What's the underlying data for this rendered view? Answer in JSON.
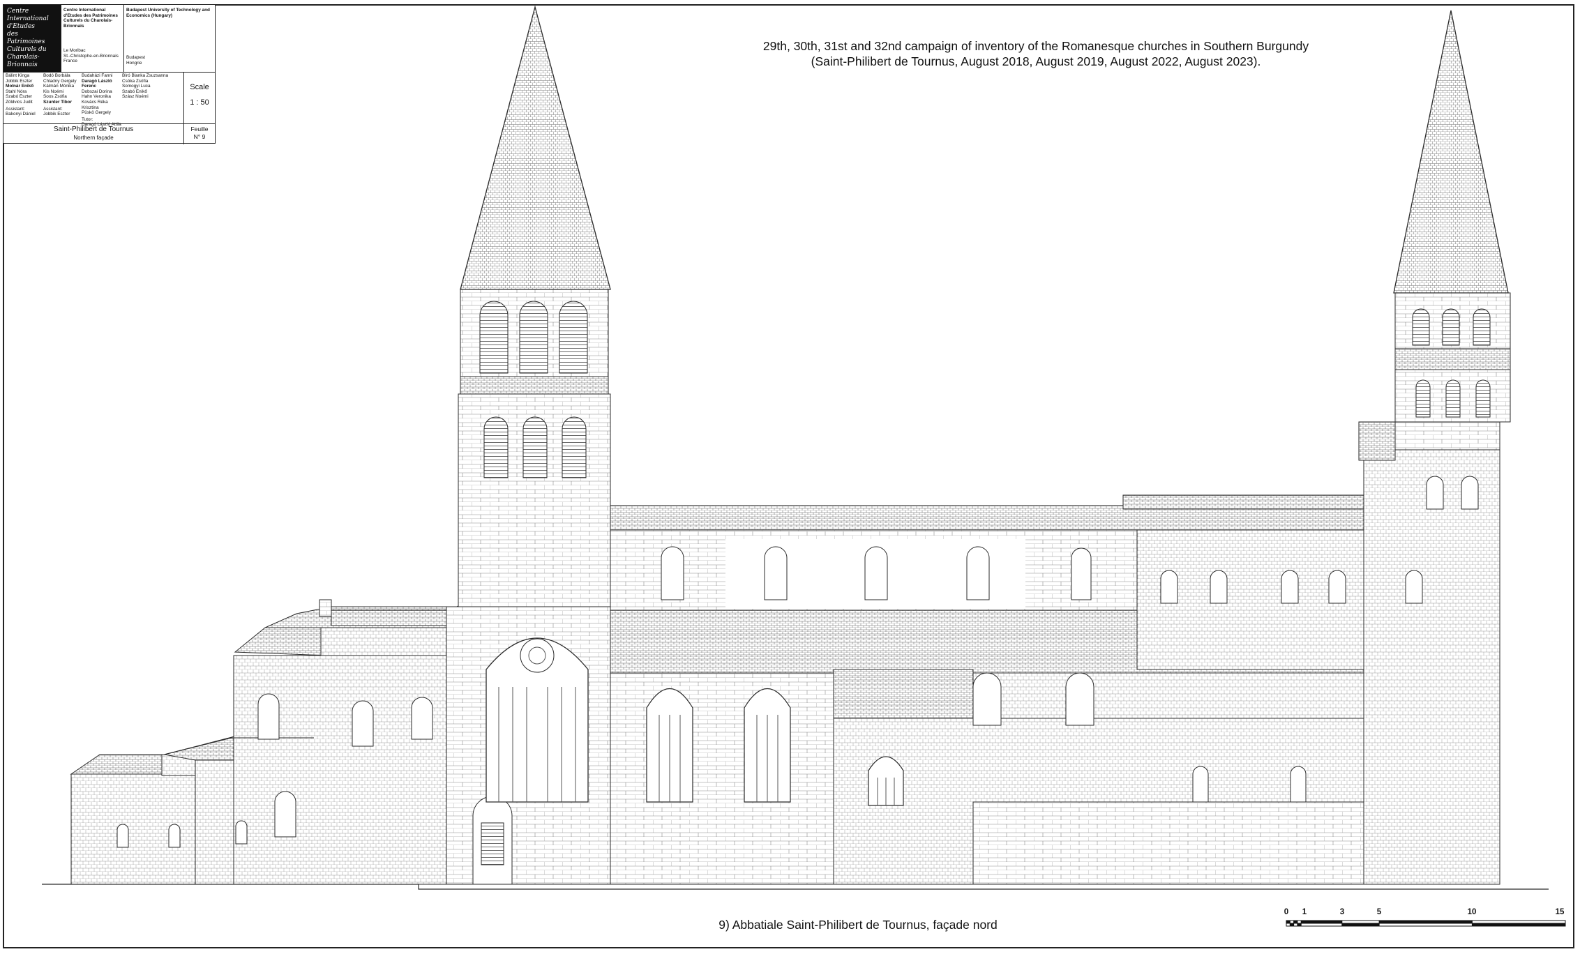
{
  "title_block": {
    "logo_lines": [
      "Centre",
      "International",
      "d'Etudes",
      "des Patrimoines",
      "Culturels du",
      "Charolais-Brionnais"
    ],
    "institution_left": {
      "name": "Centre International d'Etudes des Patrimoines Culturels du Charolais-Brionnais",
      "address": [
        "Le Moribac",
        "St.-Christophe-en-Brionnais",
        "France"
      ]
    },
    "institution_right": {
      "name": "Budapest University of Technology and Economics (Hungary)",
      "address": [
        "Budapest",
        "Hongrie"
      ]
    },
    "team_columns": [
      [
        "Bálint Kinga",
        "Jobbik Eszter",
        "Molnár Enikő",
        "Stahl Nóra",
        "Szabó Eszter",
        "Zöldvics Judit"
      ],
      [
        "Bodó Borbála",
        "Chladny Gergely",
        "Kálmán Mónika",
        "Kis Noémi",
        "Soos Zsófia",
        "Szunter Tibor"
      ],
      [
        "Budaházi Fanni",
        "Daragó László Ferenc",
        "Dobszai Dorina",
        "Hahn Veronika",
        "Kovács Réka Krisztina",
        "Püskö Gergely"
      ],
      [
        "Bíró Blanka Zsuzsanna",
        "Csóka Zsófia",
        "Somogyi Luca",
        "Szabó Enikő",
        "Szász Noémi"
      ]
    ],
    "bold_names": [
      "Molnár Enikő",
      "Szunter Tibor",
      "Daragó László Ferenc"
    ],
    "assistant_label": "Assistant:",
    "assistants": [
      "Bakonyi Dániel",
      "Jobbik Eszter"
    ],
    "tutor_label": "Tutor:",
    "tutor": "Daragó László Attila",
    "scale_label": "Scale",
    "scale_value": "1 : 50",
    "church": "Saint-Philibert de Tournus",
    "view": "Northern façade",
    "sheet_label": "Feuille",
    "sheet_number": "N° 9"
  },
  "campaign_title": "29th, 30th, 31st and 32nd campaign of inventory of the Romanesque churches in Southern Burgundy",
  "campaign_subtitle": "(Saint-Philibert de Tournus, August 2018, August 2019, August 2022, August 2023).",
  "caption": "9) Abbatiale Saint-Philibert de Tournus, façade nord",
  "scale_bar": {
    "labels": [
      "0",
      "1",
      "3",
      "5",
      "10",
      "15"
    ],
    "values": [
      0,
      1,
      3,
      5,
      10,
      15
    ],
    "unit_segments": 5
  },
  "colors": {
    "line": "#2a2a2a",
    "paper": "#ffffff"
  }
}
